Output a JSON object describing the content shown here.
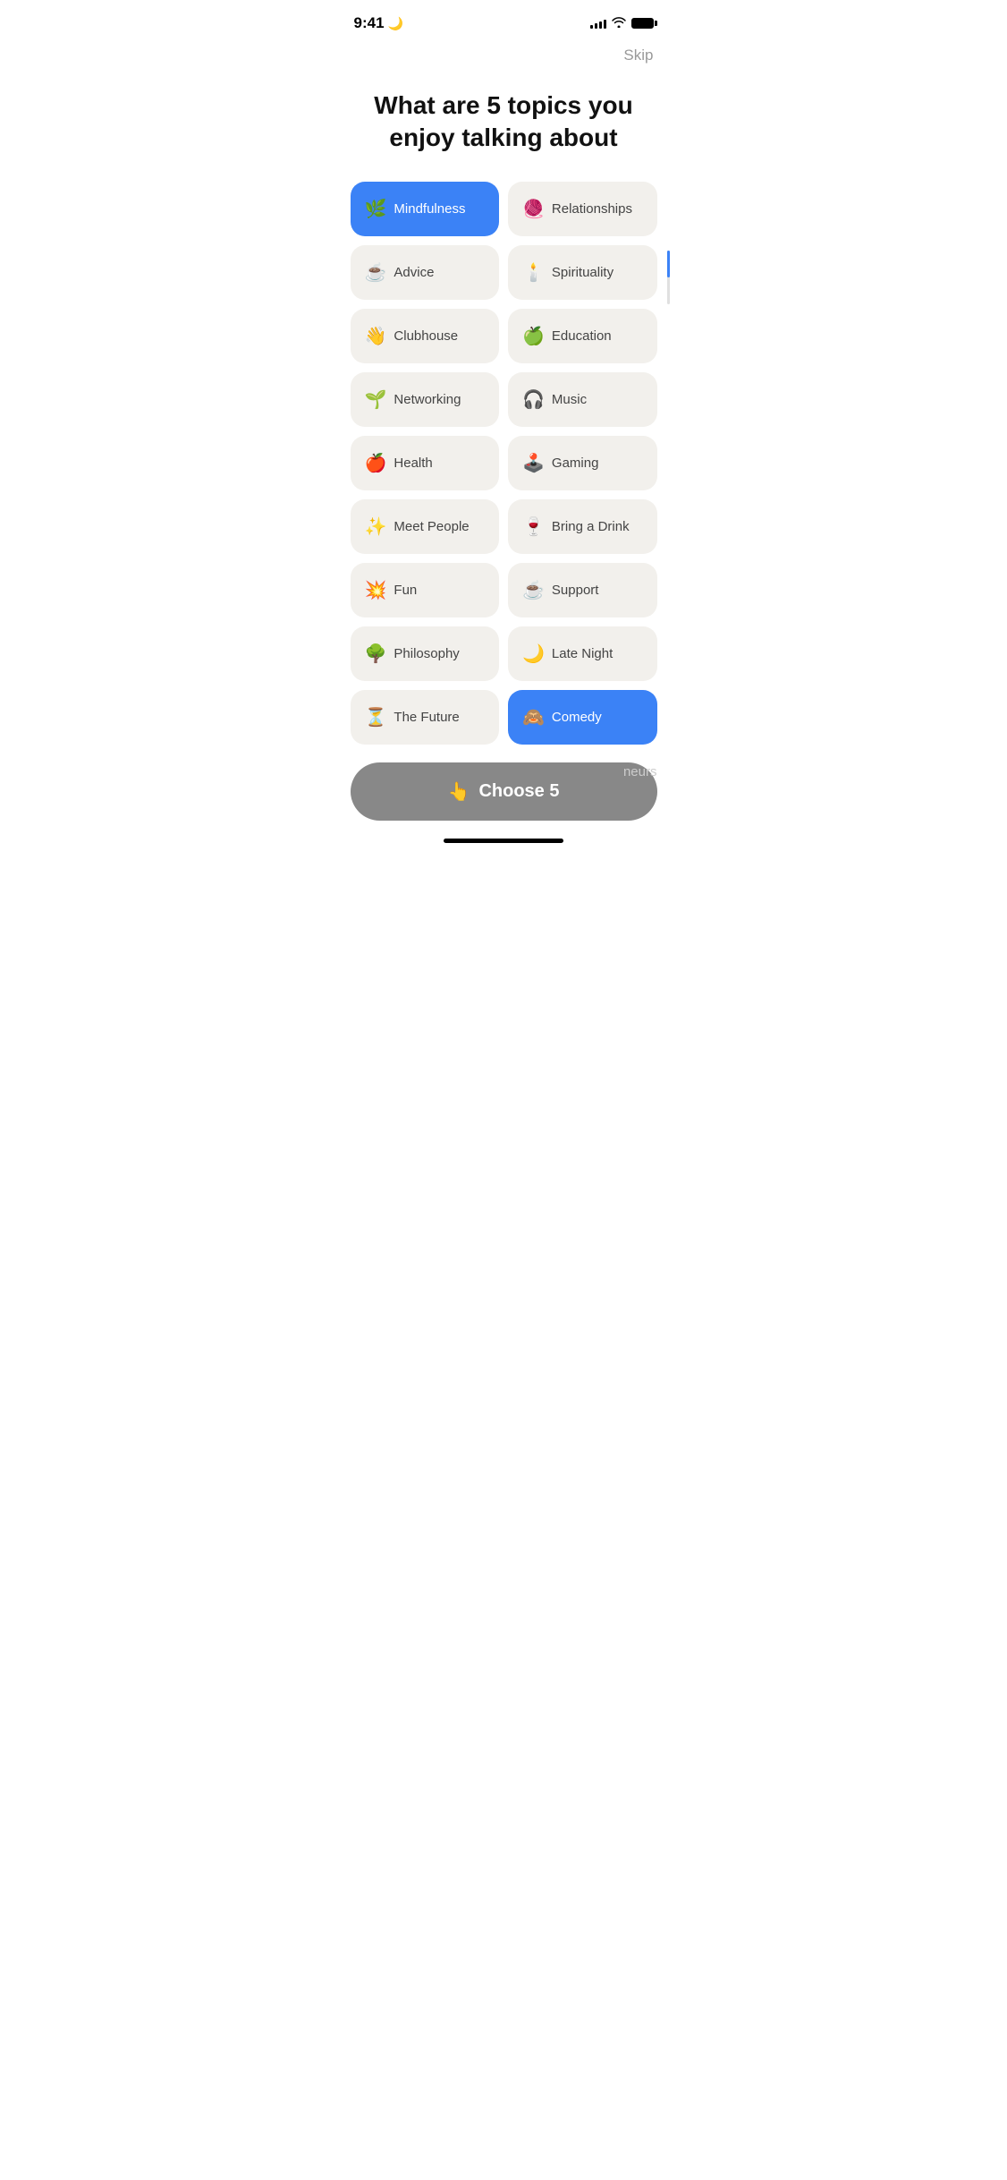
{
  "statusBar": {
    "time": "9:41",
    "moonIcon": "🌙"
  },
  "header": {
    "skipLabel": "Skip",
    "title": "What are 5 topics you enjoy talking about"
  },
  "topics": [
    {
      "id": "mindfulness",
      "emoji": "🌿",
      "label": "Mindfulness",
      "selected": true
    },
    {
      "id": "relationships",
      "emoji": "🧶",
      "label": "Relationships",
      "selected": false
    },
    {
      "id": "advice",
      "emoji": "☕",
      "label": "Advice",
      "selected": false
    },
    {
      "id": "spirituality",
      "emoji": "🕯️",
      "label": "Spirituality",
      "selected": false
    },
    {
      "id": "clubhouse",
      "emoji": "👋",
      "label": "Clubhouse",
      "selected": false
    },
    {
      "id": "education",
      "emoji": "🍏",
      "label": "Education",
      "selected": false
    },
    {
      "id": "networking",
      "emoji": "🌱",
      "label": "Networking",
      "selected": false
    },
    {
      "id": "music",
      "emoji": "🎧",
      "label": "Music",
      "selected": false
    },
    {
      "id": "health",
      "emoji": "🍎",
      "label": "Health",
      "selected": false
    },
    {
      "id": "gaming",
      "emoji": "🕹️",
      "label": "Gaming",
      "selected": false
    },
    {
      "id": "meet-people",
      "emoji": "✨",
      "label": "Meet People",
      "selected": false
    },
    {
      "id": "bring-a-drink",
      "emoji": "🍷",
      "label": "Bring a Drink",
      "selected": false
    },
    {
      "id": "fun",
      "emoji": "💥",
      "label": "Fun",
      "selected": false
    },
    {
      "id": "support",
      "emoji": "☕",
      "label": "Support",
      "selected": false
    },
    {
      "id": "philosophy",
      "emoji": "🌳",
      "label": "Philosophy",
      "selected": false
    },
    {
      "id": "late-night",
      "emoji": "🌙",
      "label": "Late Night",
      "selected": false
    },
    {
      "id": "the-future",
      "emoji": "⏳",
      "label": "The Future",
      "selected": false
    },
    {
      "id": "comedy",
      "emoji": "🙈",
      "label": "Comedy",
      "selected": true
    }
  ],
  "chooseButton": {
    "label": "Choose 5",
    "emoji": "👆"
  },
  "partialText": "neurs"
}
